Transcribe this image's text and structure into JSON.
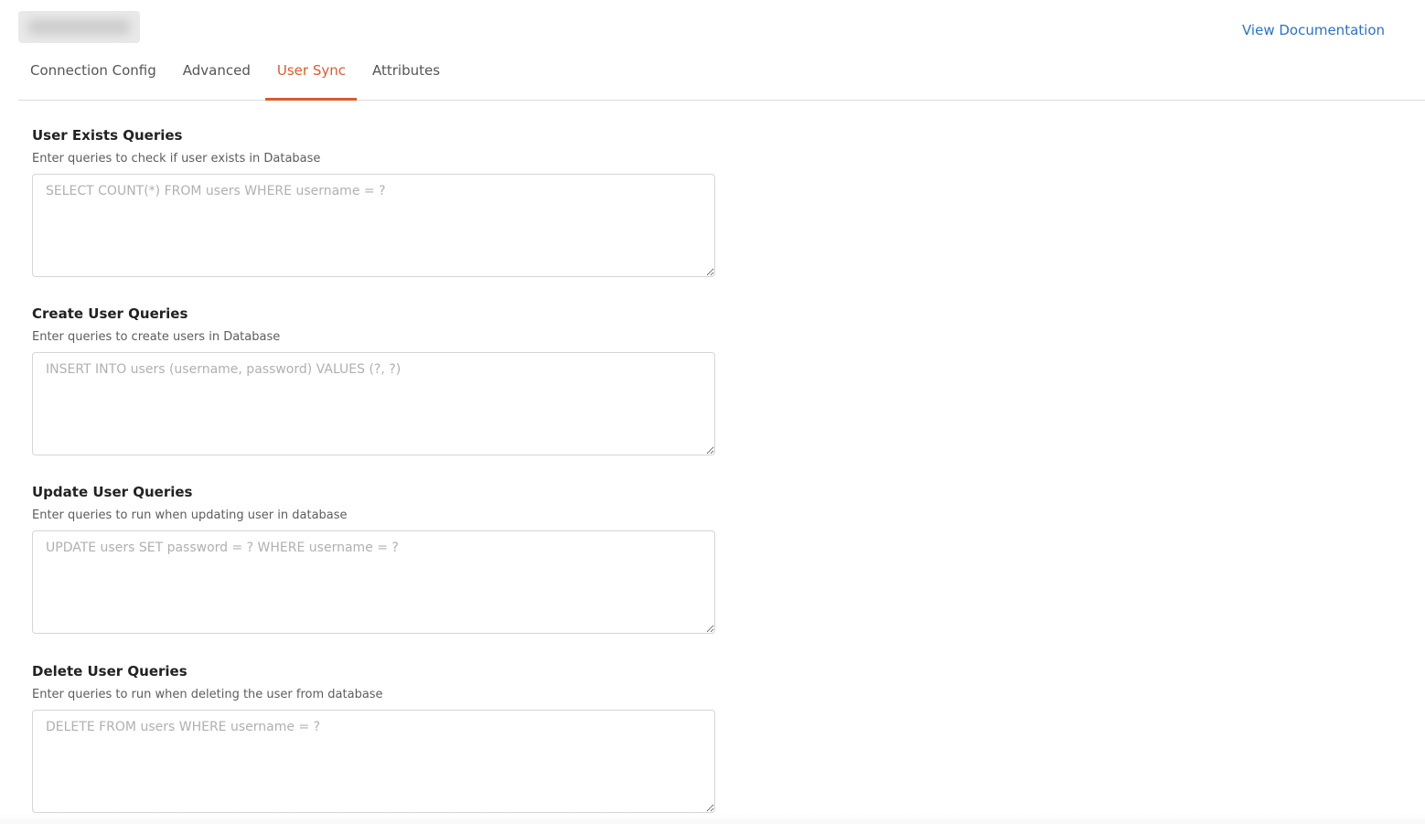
{
  "header": {
    "doc_link": "View Documentation"
  },
  "tabs": [
    {
      "label": "Connection Config",
      "active": false
    },
    {
      "label": "Advanced",
      "active": false
    },
    {
      "label": "User Sync",
      "active": true
    },
    {
      "label": "Attributes",
      "active": false
    }
  ],
  "sections": [
    {
      "title": "User Exists Queries",
      "description": "Enter queries to check if user exists in Database",
      "placeholder": "SELECT COUNT(*) FROM users WHERE username = ?",
      "value": ""
    },
    {
      "title": "Create User Queries",
      "description": "Enter queries to create users in Database",
      "placeholder": "INSERT INTO users (username, password) VALUES (?, ?)",
      "value": ""
    },
    {
      "title": "Update User Queries",
      "description": "Enter queries to run when updating user in database",
      "placeholder": "UPDATE users SET password = ? WHERE username = ?",
      "value": ""
    },
    {
      "title": "Delete User Queries",
      "description": "Enter queries to run when deleting the user from database",
      "placeholder": "DELETE FROM users WHERE username = ?",
      "value": ""
    }
  ],
  "colors": {
    "accent": "#dc5a2c",
    "link": "#2a73c5"
  }
}
